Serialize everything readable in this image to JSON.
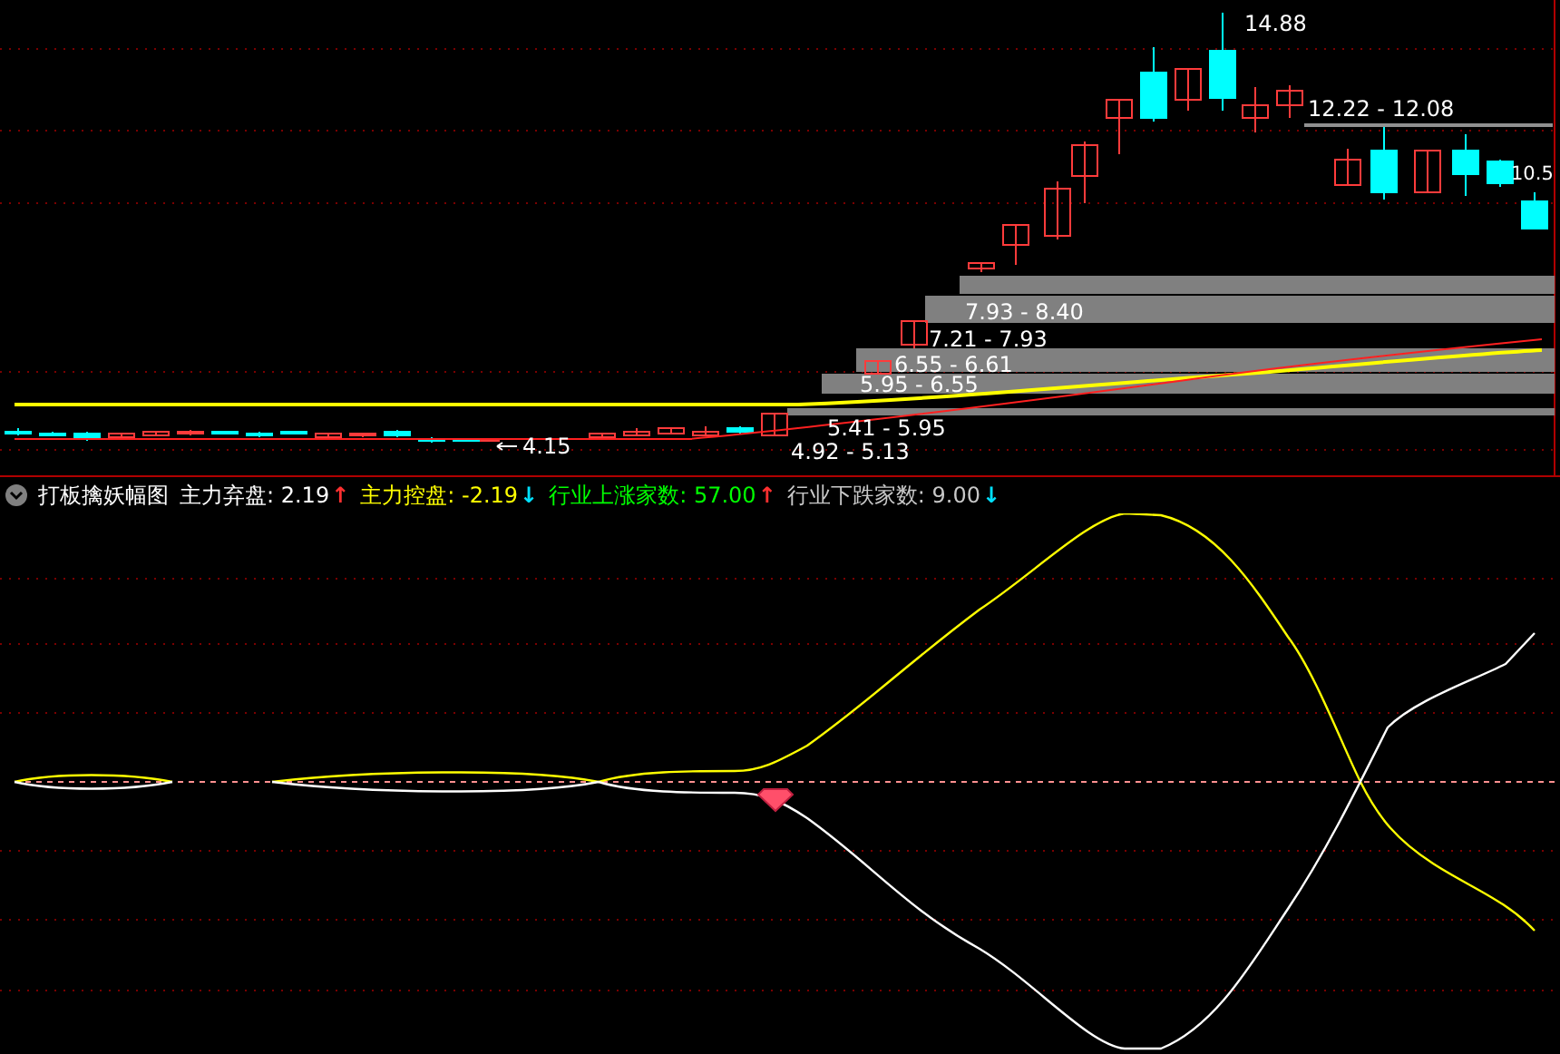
{
  "price_chart": {
    "high_label": "14.88",
    "low_label": "4.15",
    "last_label": "10.5",
    "resistance_label": "12.22 - 12.08",
    "zones": [
      {
        "label": "7.93 - 8.40"
      },
      {
        "label": "7.21 - 7.93"
      },
      {
        "label": "6.55 - 6.61"
      },
      {
        "label": "5.95 - 6.55"
      },
      {
        "label": "5.41 - 5.95"
      },
      {
        "label": "4.92 - 5.13"
      }
    ]
  },
  "indicator": {
    "title": "打板擒妖幅图",
    "readings": [
      {
        "label": "主力弃盘: 2.19",
        "color": "#ffffff",
        "kind": "up",
        "arrow": "↑"
      },
      {
        "label": "主力控盘: -2.19",
        "color": "#ffff00",
        "kind": "down",
        "arrow": "↓"
      },
      {
        "label": "行业上涨家数: 57.00",
        "color": "#00ff00",
        "kind": "up",
        "arrow": "↑"
      },
      {
        "label": "行业下跌家数: 9.00",
        "color": "#c8c8c8",
        "kind": "down",
        "arrow": "↓"
      }
    ]
  }
}
